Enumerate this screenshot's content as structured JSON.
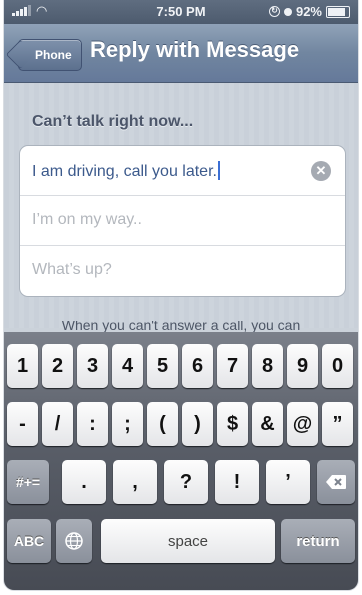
{
  "status_bar": {
    "time": "7:50 PM",
    "battery": "92%",
    "wifi_icon": "wifi-icon",
    "lock_icon": "rotation-lock-icon",
    "location_icon": "location-icon"
  },
  "nav": {
    "back_label": "Phone",
    "title": "Reply with Message"
  },
  "section": {
    "header": "Can’t talk right now..."
  },
  "messages": {
    "field1_value": "I am driving, call you later.",
    "field2_placeholder": "I’m on my way..",
    "field3_placeholder": "What’s up?"
  },
  "footnote": "When you can't answer a call, you can",
  "keyboard": {
    "row1": [
      "1",
      "2",
      "3",
      "4",
      "5",
      "6",
      "7",
      "8",
      "9",
      "0"
    ],
    "row2": [
      "-",
      "/",
      ":",
      ";",
      "(",
      ")",
      "$",
      "&",
      "@",
      "”"
    ],
    "row3_symbols_key": "#+=",
    "row3": [
      ".",
      ",",
      "?",
      "!",
      "’"
    ],
    "backspace_icon": "backspace-icon",
    "abc_key": "ABC",
    "globe_icon": "globe-icon",
    "space": "space",
    "return": "return"
  },
  "colors": {
    "navbar": "#7186a0",
    "status_bar": "#4d5b6e",
    "active_text": "#3c5a8c",
    "caret": "#3b6fd5"
  }
}
